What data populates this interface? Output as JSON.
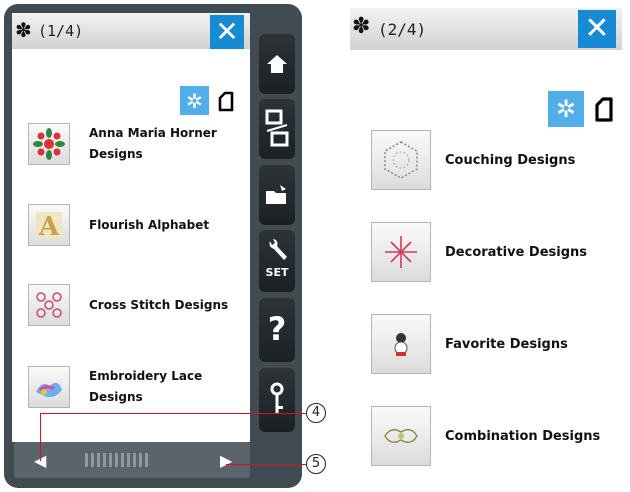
{
  "left_screen": {
    "page_indicator": "(1/4)",
    "close_icon": "✕",
    "items": [
      {
        "label_line1": "Anna Maria Horner",
        "label_line2": "Designs"
      },
      {
        "label_line1": "Flourish Alphabet",
        "label_line2": ""
      },
      {
        "label_line1": "Cross Stitch Designs",
        "label_line2": ""
      },
      {
        "label_line1": "Embroidery Lace",
        "label_line2": "Designs"
      }
    ],
    "nav": {
      "prev": "◀",
      "next": "▶"
    }
  },
  "sidebar": {
    "set_label": "SET",
    "help_label": "?"
  },
  "right_screen": {
    "page_indicator": "(2/4)",
    "close_icon": "✕",
    "items": [
      {
        "label": "Couching Designs"
      },
      {
        "label": "Decorative Designs"
      },
      {
        "label": "Favorite Designs"
      },
      {
        "label": "Combination Designs"
      }
    ]
  },
  "callouts": {
    "c4": "4",
    "c5": "5"
  },
  "colors": {
    "accent": "#178ad4",
    "toggle_active": "#52aee8",
    "frame": "#414b52"
  }
}
